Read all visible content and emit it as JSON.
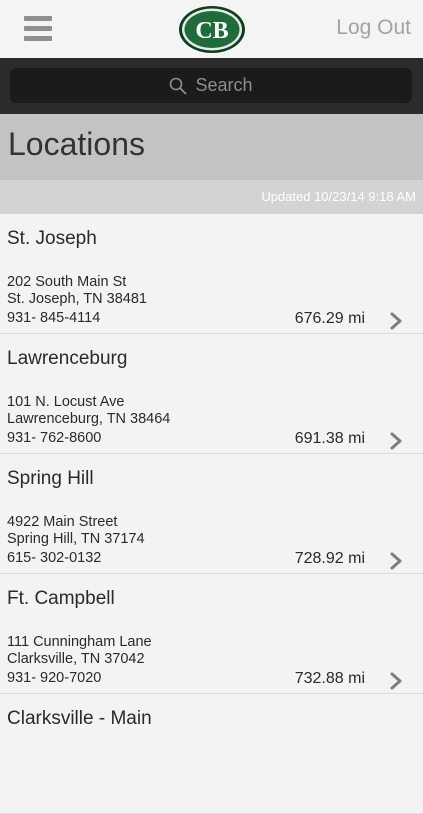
{
  "header": {
    "logo_text": "CB",
    "logout_label": "Log Out",
    "colors": {
      "logo_green": "#1f6b3a",
      "logo_frame": "#0c3f22"
    }
  },
  "search": {
    "placeholder": "Search"
  },
  "page": {
    "title": "Locations",
    "updated": "Updated 10/23/14 9:18 AM"
  },
  "locations": [
    {
      "name": "St. Joseph",
      "address1": "202 South Main St",
      "address2": "St. Joseph, TN 38481",
      "phone": "931- 845-4114",
      "distance": "676.29 mi"
    },
    {
      "name": "Lawrenceburg",
      "address1": "101 N. Locust Ave",
      "address2": "Lawrenceburg, TN 38464",
      "phone": "931- 762-8600",
      "distance": "691.38 mi"
    },
    {
      "name": "Spring Hill",
      "address1": "4922 Main Street",
      "address2": "Spring Hill, TN 37174",
      "phone": "615- 302-0132",
      "distance": "728.92 mi"
    },
    {
      "name": "Ft. Campbell",
      "address1": "111 Cunningham Lane",
      "address2": "Clarksville, TN 37042",
      "phone": "931- 920-7020",
      "distance": "732.88 mi"
    },
    {
      "name": "Clarksville - Main",
      "address1": "",
      "address2": "",
      "phone": "",
      "distance": ""
    }
  ]
}
